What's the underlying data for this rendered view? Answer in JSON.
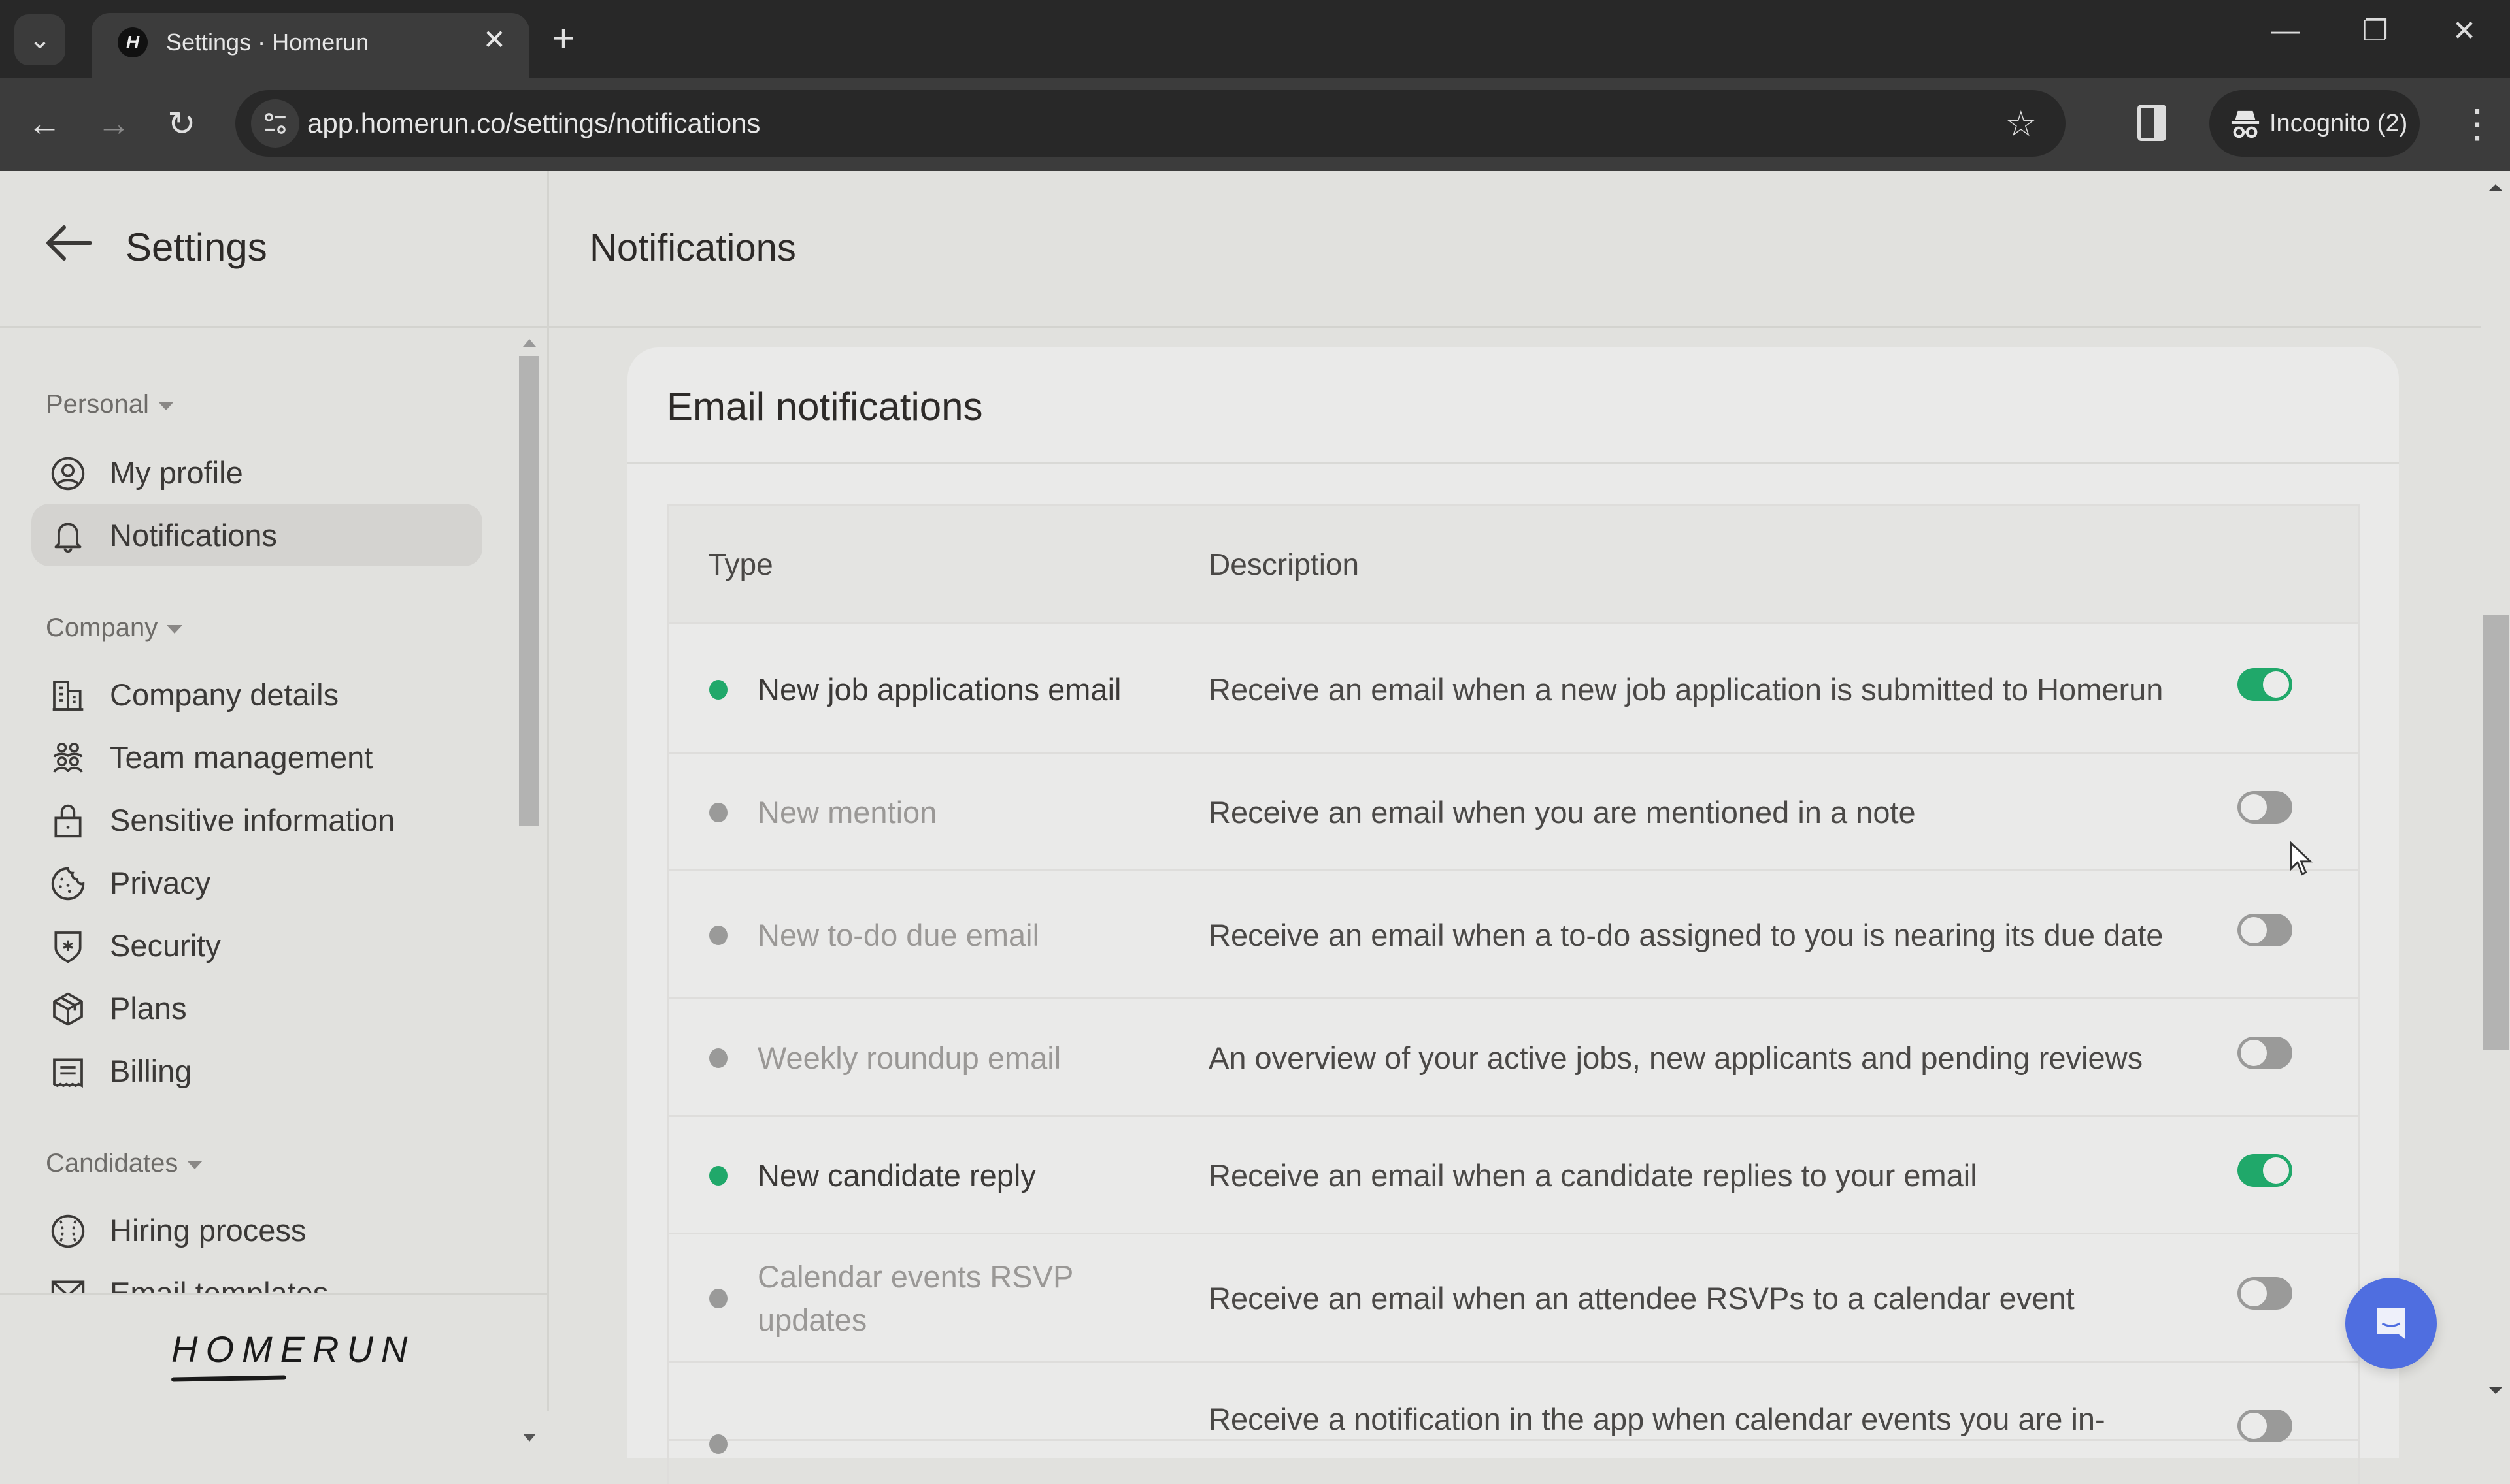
{
  "browser": {
    "tab_title": "Settings · Homerun",
    "favicon_letter": "H",
    "url": "app.homerun.co/settings/notifications",
    "incognito_label": "Incognito (2)",
    "icons": {
      "tab_search": "chevron-down-icon",
      "tab_close": "close-icon",
      "new_tab": "plus-icon",
      "minimize": "minimize-icon",
      "restore": "restore-icon",
      "close_window": "close-icon",
      "back": "arrow-left-icon",
      "forward": "arrow-right-icon",
      "reload": "reload-icon",
      "site_info": "tune-icon",
      "bookmark": "star-icon",
      "side_panel": "side-panel-icon",
      "incognito": "incognito-icon",
      "menu": "more-vert-icon"
    },
    "glyphs": {
      "tab_search": "⌄",
      "tab_close": "✕",
      "new_tab": "+",
      "minimize": "—",
      "restore": "❐",
      "close_window": "✕",
      "back": "←",
      "forward": "→",
      "reload": "↻",
      "site_info": "⚙",
      "bookmark": "☆",
      "menu": "⋮"
    }
  },
  "sidebar": {
    "title": "Settings",
    "sections": [
      {
        "label": "Personal",
        "items": [
          {
            "label": "My profile",
            "icon": "user-circle-icon",
            "active": false
          },
          {
            "label": "Notifications",
            "icon": "bell-icon",
            "active": true
          }
        ]
      },
      {
        "label": "Company",
        "items": [
          {
            "label": "Company details",
            "icon": "building-icon",
            "active": false
          },
          {
            "label": "Team management",
            "icon": "team-icon",
            "active": false
          },
          {
            "label": "Sensitive information",
            "icon": "lock-icon",
            "active": false
          },
          {
            "label": "Privacy",
            "icon": "cookie-icon",
            "active": false
          },
          {
            "label": "Security",
            "icon": "shield-icon",
            "active": false
          },
          {
            "label": "Plans",
            "icon": "package-icon",
            "active": false
          },
          {
            "label": "Billing",
            "icon": "receipt-icon",
            "active": false
          }
        ]
      },
      {
        "label": "Candidates",
        "items": [
          {
            "label": "Hiring process",
            "icon": "baseball-icon",
            "active": false
          },
          {
            "label": "Email templates",
            "icon": "mail-icon",
            "active": false
          }
        ]
      }
    ],
    "logo": "HOMERUN"
  },
  "main": {
    "page_title": "Notifications",
    "card_title": "Email notifications",
    "columns": [
      "Type",
      "Description"
    ],
    "rows": [
      {
        "type": "New job applications email",
        "description": "Receive an email when a new job application is submitted to Homerun",
        "enabled": true
      },
      {
        "type": "New mention",
        "description": "Receive an email when you are mentioned in a note",
        "enabled": false
      },
      {
        "type": "New to-do due email",
        "description": "Receive an email when a to-do assigned to you is nearing its due date",
        "enabled": false
      },
      {
        "type": "Weekly roundup email",
        "description": "An overview of your active jobs, new applicants and pending reviews",
        "enabled": false
      },
      {
        "type": "New candidate reply",
        "description": "Receive an email when a candidate replies to your email",
        "enabled": true
      },
      {
        "type": "Calendar events RSVP updates",
        "description": "Receive an email when an attendee RSVPs to a calendar event",
        "enabled": false
      },
      {
        "type": "",
        "description": "Receive a notification in the app when calendar events you are in-",
        "enabled": false
      }
    ]
  },
  "colors": {
    "accent_on": "#20a86a",
    "toggle_off": "#9a9a99",
    "dot_off": "#9a9a99",
    "text_enabled": "#3b3937",
    "text_disabled": "#9a9896",
    "chat_button": "#4f6ee0"
  },
  "chat_widget": {
    "icon": "chat-icon"
  }
}
